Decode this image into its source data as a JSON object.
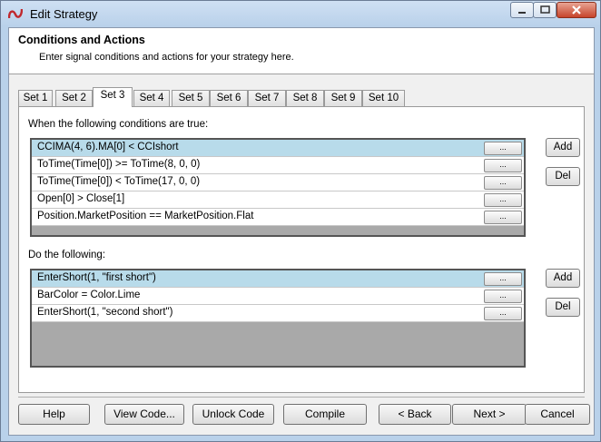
{
  "window": {
    "title": "Edit Strategy"
  },
  "header": {
    "title": "Conditions and Actions",
    "subtitle": "Enter signal conditions and actions for your strategy here."
  },
  "tabs": [
    {
      "label": "Set 1"
    },
    {
      "label": "Set 2"
    },
    {
      "label": "Set 3",
      "active": true
    },
    {
      "label": "Set 4"
    },
    {
      "label": "Set 5"
    },
    {
      "label": "Set 6"
    },
    {
      "label": "Set 7"
    },
    {
      "label": "Set 8"
    },
    {
      "label": "Set 9"
    },
    {
      "label": "Set 10"
    }
  ],
  "conditions": {
    "label": "When the following conditions are true:",
    "rows": [
      {
        "text": "CCIMA(4, 6).MA[0] < CCIshort",
        "button": "...",
        "selected": true
      },
      {
        "text": "ToTime(Time[0]) >= ToTime(8, 0, 0)",
        "button": "..."
      },
      {
        "text": "ToTime(Time[0]) < ToTime(17, 0, 0)",
        "button": "..."
      },
      {
        "text": "Open[0] > Close[1]",
        "button": "..."
      },
      {
        "text": "Position.MarketPosition == MarketPosition.Flat",
        "button": "..."
      }
    ],
    "add_label": "Add",
    "del_label": "Del"
  },
  "actions": {
    "label": "Do the following:",
    "rows": [
      {
        "text": "EnterShort(1, \"first short\")",
        "button": "...",
        "selected": true
      },
      {
        "text": "BarColor = Color.Lime",
        "button": "..."
      },
      {
        "text": "EnterShort(1, \"second short\")",
        "button": "..."
      }
    ],
    "add_label": "Add",
    "del_label": "Del"
  },
  "footer": {
    "help": "Help",
    "view_code": "View Code...",
    "unlock_code": "Unlock Code",
    "compile": "Compile",
    "back": "< Back",
    "next": "Next >",
    "cancel": "Cancel"
  },
  "colors": {
    "selected_row": "#b8dbea",
    "grid_background": "#a9a9a9",
    "window_frame": "#b9d1ea"
  },
  "icons": {
    "app": "ninjatrader-logo-icon",
    "minimize": "minimize-icon",
    "maximize": "maximize-icon",
    "close": "close-icon"
  }
}
